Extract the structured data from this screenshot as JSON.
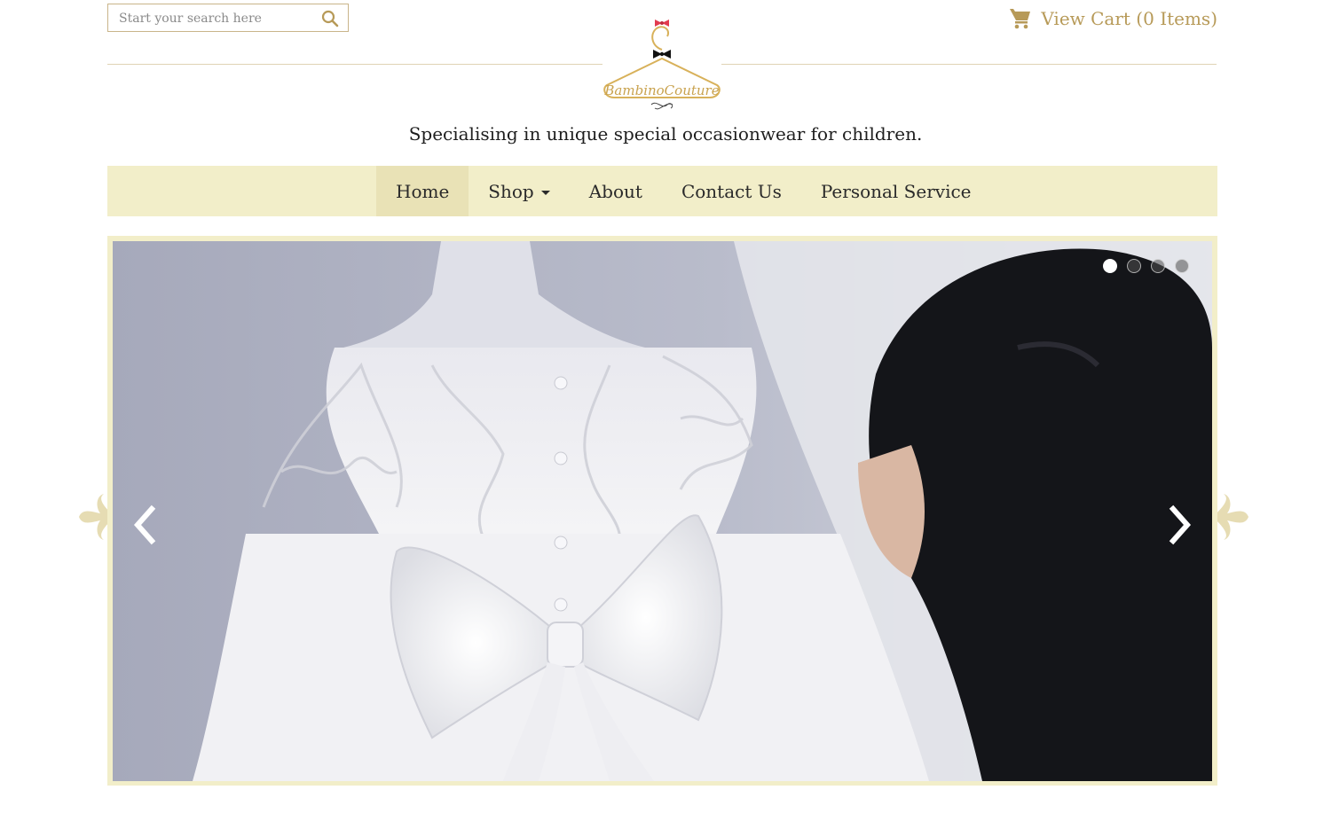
{
  "search": {
    "placeholder": "Start your search here",
    "icon": "search-icon"
  },
  "cart": {
    "label": "View Cart (0 Items)",
    "icon": "cart-icon"
  },
  "brand": {
    "logo_text": "BambinoCouture",
    "tagline": "Specialising in unique special occasionwear for children."
  },
  "nav": {
    "items": [
      {
        "label": "Home",
        "active": true
      },
      {
        "label": "Shop",
        "dropdown": true
      },
      {
        "label": "About"
      },
      {
        "label": "Contact Us"
      },
      {
        "label": "Personal Service"
      }
    ]
  },
  "slider": {
    "slides": 4,
    "current_slide": 1,
    "prev_icon": "chevron-left-icon",
    "next_icon": "chevron-right-icon"
  },
  "colors": {
    "accent_gold": "#b79a58",
    "nav_bg": "#f2eec9",
    "nav_active_bg": "#e9e2b6",
    "rule": "#e0d3b4"
  }
}
